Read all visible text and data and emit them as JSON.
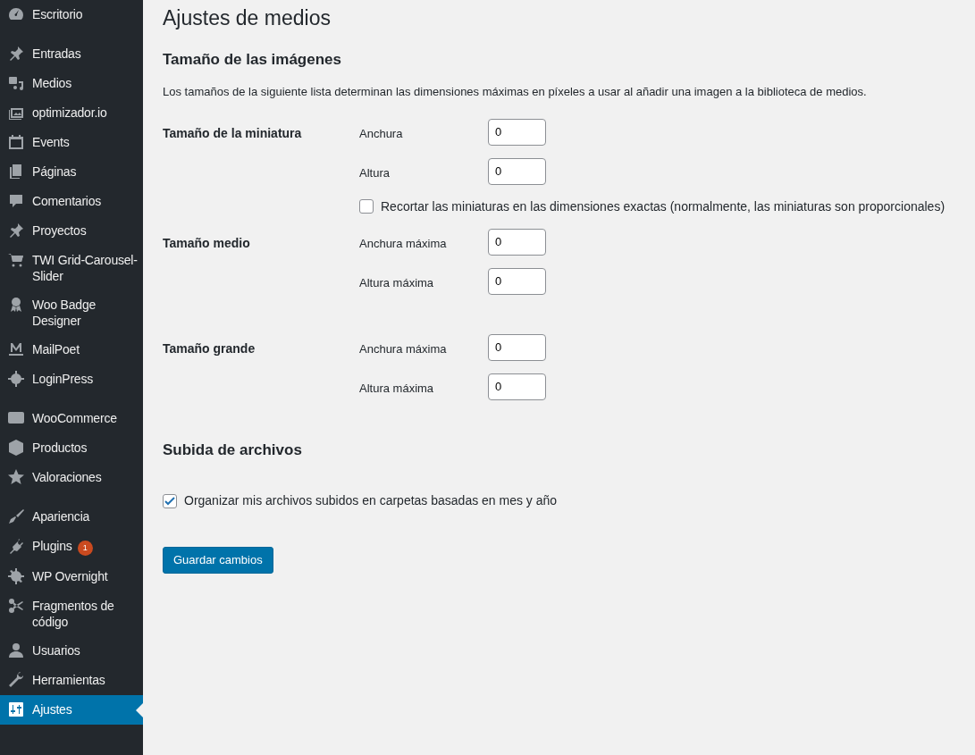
{
  "sidebar": {
    "groups": [
      [
        {
          "label": "Escritorio",
          "selected": false
        }
      ],
      [
        {
          "label": "Entradas",
          "selected": false
        },
        {
          "label": "Medios",
          "selected": false
        },
        {
          "label": "optimizador.io",
          "selected": false
        },
        {
          "label": "Events",
          "selected": false
        },
        {
          "label": "Páginas",
          "selected": false
        },
        {
          "label": "Comentarios",
          "selected": false
        },
        {
          "label": "Proyectos",
          "selected": false
        },
        {
          "label": "TWI Grid-Carousel-Slider",
          "selected": false
        },
        {
          "label": "Woo Badge Designer",
          "selected": false
        },
        {
          "label": "MailPoet",
          "selected": false
        },
        {
          "label": "LoginPress",
          "selected": false
        }
      ],
      [
        {
          "label": "WooCommerce",
          "selected": false
        },
        {
          "label": "Productos",
          "selected": false
        },
        {
          "label": "Valoraciones",
          "selected": false
        }
      ],
      [
        {
          "label": "Apariencia",
          "selected": false
        },
        {
          "label": "Plugins",
          "selected": false,
          "badge": "1"
        },
        {
          "label": "WP Overnight",
          "selected": false
        },
        {
          "label": "Fragmentos de código",
          "selected": false
        },
        {
          "label": "Usuarios",
          "selected": false
        },
        {
          "label": "Herramientas",
          "selected": false
        },
        {
          "label": "Ajustes",
          "selected": true
        }
      ]
    ]
  },
  "page_title": "Ajustes de medios",
  "image_sizes": {
    "heading": "Tamaño de las imágenes",
    "description": "Los tamaños de la siguiente lista determinan las dimensiones máximas en píxeles a usar al añadir una imagen a la biblioteca de medios.",
    "rows": [
      {
        "label": "Tamaño de la miniatura",
        "fields": [
          {
            "label": "Anchura",
            "value": "0"
          },
          {
            "label": "Altura",
            "value": "0"
          }
        ],
        "checkbox": {
          "label": "Recortar las miniaturas en las dimensiones exactas (normalmente, las miniaturas son proporcionales)",
          "checked": false
        }
      },
      {
        "label": "Tamaño medio",
        "fields": [
          {
            "label": "Anchura máxima",
            "value": "0"
          },
          {
            "label": "Altura máxima",
            "value": "0"
          }
        ]
      },
      {
        "label": "Tamaño grande",
        "fields": [
          {
            "label": "Anchura máxima",
            "value": "0"
          },
          {
            "label": "Altura máxima",
            "value": "0"
          }
        ]
      }
    ]
  },
  "uploads": {
    "heading": "Subida de archivos",
    "checkbox": {
      "label": "Organizar mis archivos subidos en carpetas basadas en mes y año",
      "checked": true
    }
  },
  "save_button": "Guardar cambios"
}
